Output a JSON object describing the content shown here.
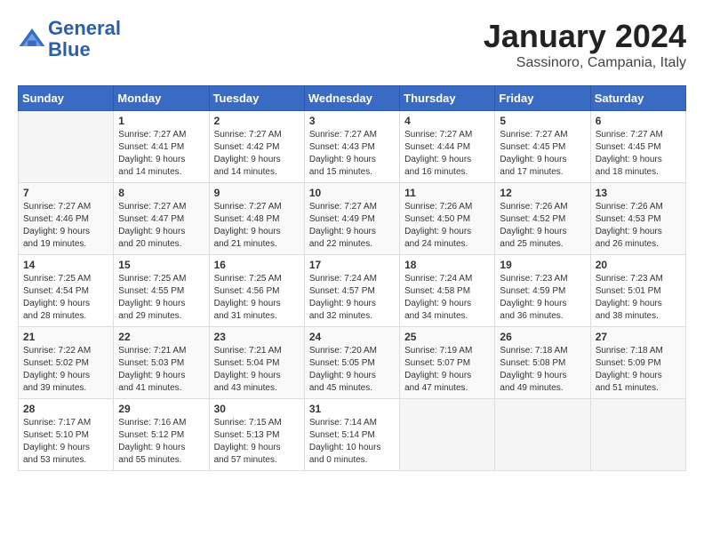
{
  "header": {
    "logo": {
      "line1": "General",
      "line2": "Blue"
    },
    "title": "January 2024",
    "location": "Sassinoro, Campania, Italy"
  },
  "days_of_week": [
    "Sunday",
    "Monday",
    "Tuesday",
    "Wednesday",
    "Thursday",
    "Friday",
    "Saturday"
  ],
  "weeks": [
    [
      {
        "day": "",
        "info": ""
      },
      {
        "day": "1",
        "info": "Sunrise: 7:27 AM\nSunset: 4:41 PM\nDaylight: 9 hours\nand 14 minutes."
      },
      {
        "day": "2",
        "info": "Sunrise: 7:27 AM\nSunset: 4:42 PM\nDaylight: 9 hours\nand 14 minutes."
      },
      {
        "day": "3",
        "info": "Sunrise: 7:27 AM\nSunset: 4:43 PM\nDaylight: 9 hours\nand 15 minutes."
      },
      {
        "day": "4",
        "info": "Sunrise: 7:27 AM\nSunset: 4:44 PM\nDaylight: 9 hours\nand 16 minutes."
      },
      {
        "day": "5",
        "info": "Sunrise: 7:27 AM\nSunset: 4:45 PM\nDaylight: 9 hours\nand 17 minutes."
      },
      {
        "day": "6",
        "info": "Sunrise: 7:27 AM\nSunset: 4:45 PM\nDaylight: 9 hours\nand 18 minutes."
      }
    ],
    [
      {
        "day": "7",
        "info": "Sunrise: 7:27 AM\nSunset: 4:46 PM\nDaylight: 9 hours\nand 19 minutes."
      },
      {
        "day": "8",
        "info": "Sunrise: 7:27 AM\nSunset: 4:47 PM\nDaylight: 9 hours\nand 20 minutes."
      },
      {
        "day": "9",
        "info": "Sunrise: 7:27 AM\nSunset: 4:48 PM\nDaylight: 9 hours\nand 21 minutes."
      },
      {
        "day": "10",
        "info": "Sunrise: 7:27 AM\nSunset: 4:49 PM\nDaylight: 9 hours\nand 22 minutes."
      },
      {
        "day": "11",
        "info": "Sunrise: 7:26 AM\nSunset: 4:50 PM\nDaylight: 9 hours\nand 24 minutes."
      },
      {
        "day": "12",
        "info": "Sunrise: 7:26 AM\nSunset: 4:52 PM\nDaylight: 9 hours\nand 25 minutes."
      },
      {
        "day": "13",
        "info": "Sunrise: 7:26 AM\nSunset: 4:53 PM\nDaylight: 9 hours\nand 26 minutes."
      }
    ],
    [
      {
        "day": "14",
        "info": "Sunrise: 7:25 AM\nSunset: 4:54 PM\nDaylight: 9 hours\nand 28 minutes."
      },
      {
        "day": "15",
        "info": "Sunrise: 7:25 AM\nSunset: 4:55 PM\nDaylight: 9 hours\nand 29 minutes."
      },
      {
        "day": "16",
        "info": "Sunrise: 7:25 AM\nSunset: 4:56 PM\nDaylight: 9 hours\nand 31 minutes."
      },
      {
        "day": "17",
        "info": "Sunrise: 7:24 AM\nSunset: 4:57 PM\nDaylight: 9 hours\nand 32 minutes."
      },
      {
        "day": "18",
        "info": "Sunrise: 7:24 AM\nSunset: 4:58 PM\nDaylight: 9 hours\nand 34 minutes."
      },
      {
        "day": "19",
        "info": "Sunrise: 7:23 AM\nSunset: 4:59 PM\nDaylight: 9 hours\nand 36 minutes."
      },
      {
        "day": "20",
        "info": "Sunrise: 7:23 AM\nSunset: 5:01 PM\nDaylight: 9 hours\nand 38 minutes."
      }
    ],
    [
      {
        "day": "21",
        "info": "Sunrise: 7:22 AM\nSunset: 5:02 PM\nDaylight: 9 hours\nand 39 minutes."
      },
      {
        "day": "22",
        "info": "Sunrise: 7:21 AM\nSunset: 5:03 PM\nDaylight: 9 hours\nand 41 minutes."
      },
      {
        "day": "23",
        "info": "Sunrise: 7:21 AM\nSunset: 5:04 PM\nDaylight: 9 hours\nand 43 minutes."
      },
      {
        "day": "24",
        "info": "Sunrise: 7:20 AM\nSunset: 5:05 PM\nDaylight: 9 hours\nand 45 minutes."
      },
      {
        "day": "25",
        "info": "Sunrise: 7:19 AM\nSunset: 5:07 PM\nDaylight: 9 hours\nand 47 minutes."
      },
      {
        "day": "26",
        "info": "Sunrise: 7:18 AM\nSunset: 5:08 PM\nDaylight: 9 hours\nand 49 minutes."
      },
      {
        "day": "27",
        "info": "Sunrise: 7:18 AM\nSunset: 5:09 PM\nDaylight: 9 hours\nand 51 minutes."
      }
    ],
    [
      {
        "day": "28",
        "info": "Sunrise: 7:17 AM\nSunset: 5:10 PM\nDaylight: 9 hours\nand 53 minutes."
      },
      {
        "day": "29",
        "info": "Sunrise: 7:16 AM\nSunset: 5:12 PM\nDaylight: 9 hours\nand 55 minutes."
      },
      {
        "day": "30",
        "info": "Sunrise: 7:15 AM\nSunset: 5:13 PM\nDaylight: 9 hours\nand 57 minutes."
      },
      {
        "day": "31",
        "info": "Sunrise: 7:14 AM\nSunset: 5:14 PM\nDaylight: 10 hours\nand 0 minutes."
      },
      {
        "day": "",
        "info": ""
      },
      {
        "day": "",
        "info": ""
      },
      {
        "day": "",
        "info": ""
      }
    ]
  ]
}
